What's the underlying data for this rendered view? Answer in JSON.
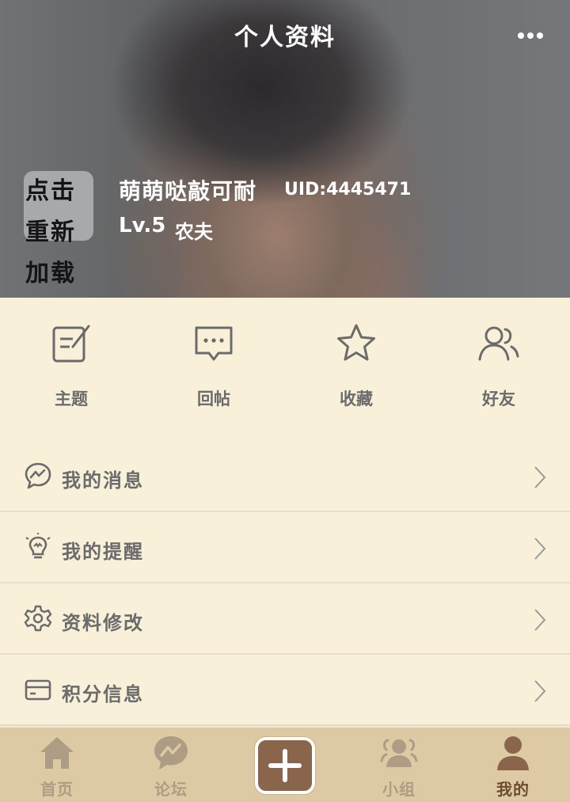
{
  "header": {
    "title": "个人资料",
    "more_icon": "more-dots-icon",
    "reload_text": "点击重新加载",
    "user_name": "萌萌哒敲可耐",
    "uid": "UID:4445471",
    "level": "Lv.5",
    "rank": "农夫"
  },
  "actions": [
    {
      "label": "主题",
      "icon": "edit-note-icon"
    },
    {
      "label": "回帖",
      "icon": "reply-bubble-icon"
    },
    {
      "label": "收藏",
      "icon": "star-icon"
    },
    {
      "label": "好友",
      "icon": "friends-icon"
    }
  ],
  "menu": [
    {
      "label": "我的消息",
      "icon": "message-icon"
    },
    {
      "label": "我的提醒",
      "icon": "lightbulb-icon"
    },
    {
      "label": "资料修改",
      "icon": "gear-icon"
    },
    {
      "label": "积分信息",
      "icon": "card-icon"
    }
  ],
  "tabs": [
    {
      "label": "首页",
      "icon": "home-icon"
    },
    {
      "label": "论坛",
      "icon": "forum-icon"
    },
    {
      "label": "",
      "icon": "plus-icon"
    },
    {
      "label": "小组",
      "icon": "group-icon"
    },
    {
      "label": "我的",
      "icon": "profile-icon",
      "active": true
    }
  ],
  "colors": {
    "background": "#f9f0da",
    "text_gray": "#6b6b6b",
    "tabbar": "#ddc9a3",
    "tab_inactive": "#ae9c84",
    "tab_active": "#6e4c33",
    "add_button": "#8b654b"
  }
}
